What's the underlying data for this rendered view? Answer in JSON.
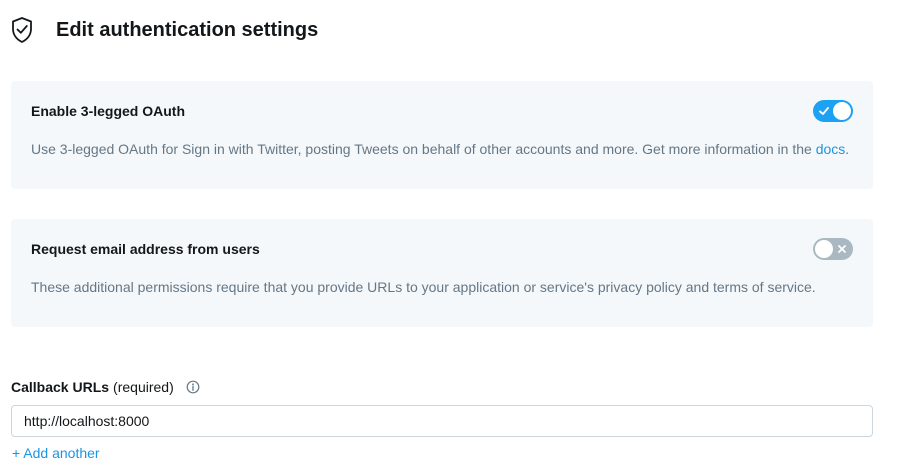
{
  "header": {
    "icon": "shield-check-icon",
    "title": "Edit authentication settings"
  },
  "oauth": {
    "title": "Enable 3-legged OAuth",
    "description": "Use 3-legged OAuth for Sign in with Twitter, posting Tweets on behalf of other accounts and more. Get more information in the ",
    "docs_link": "docs",
    "description_end": ".",
    "enabled": true
  },
  "email": {
    "title": "Request email address from users",
    "description": "These additional permissions require that you provide URLs to your application or service's privacy policy and terms of service.",
    "enabled": false
  },
  "callback": {
    "label": "Callback URLs",
    "qualifier": "(required)",
    "info_icon": "info-icon",
    "value": "http://localhost:8000",
    "add_label": "+ Add another"
  },
  "colors": {
    "accent": "#1da1f2",
    "link": "#1b95e0",
    "card_bg": "#f5f8fa",
    "toggle_off": "#aab8c2"
  }
}
